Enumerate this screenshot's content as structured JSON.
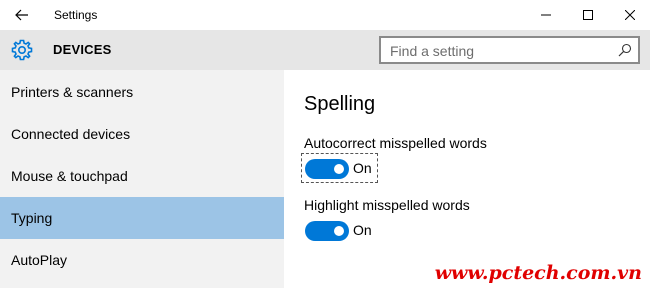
{
  "window": {
    "title": "Settings",
    "controls": [
      "minimize",
      "maximize",
      "close"
    ]
  },
  "header": {
    "title": "DEVICES",
    "icon": "gear-icon"
  },
  "search": {
    "placeholder": "Find a setting"
  },
  "sidebar": {
    "items": [
      {
        "label": "Printers & scanners",
        "selected": false
      },
      {
        "label": "Connected devices",
        "selected": false
      },
      {
        "label": "Mouse & touchpad",
        "selected": false
      },
      {
        "label": "Typing",
        "selected": true
      },
      {
        "label": "AutoPlay",
        "selected": false
      }
    ]
  },
  "main": {
    "section_title": "Spelling",
    "settings": [
      {
        "label": "Autocorrect misspelled words",
        "state": "On",
        "value": true
      },
      {
        "label": "Highlight misspelled words",
        "state": "On",
        "value": true
      }
    ]
  },
  "watermark": "www.pctech.com.vn",
  "colors": {
    "accent": "#0078d7",
    "selected": "#9cc4e6",
    "header": "#e6e6e6",
    "sidebar": "#f2f2f2",
    "watermark": "#e00000"
  }
}
